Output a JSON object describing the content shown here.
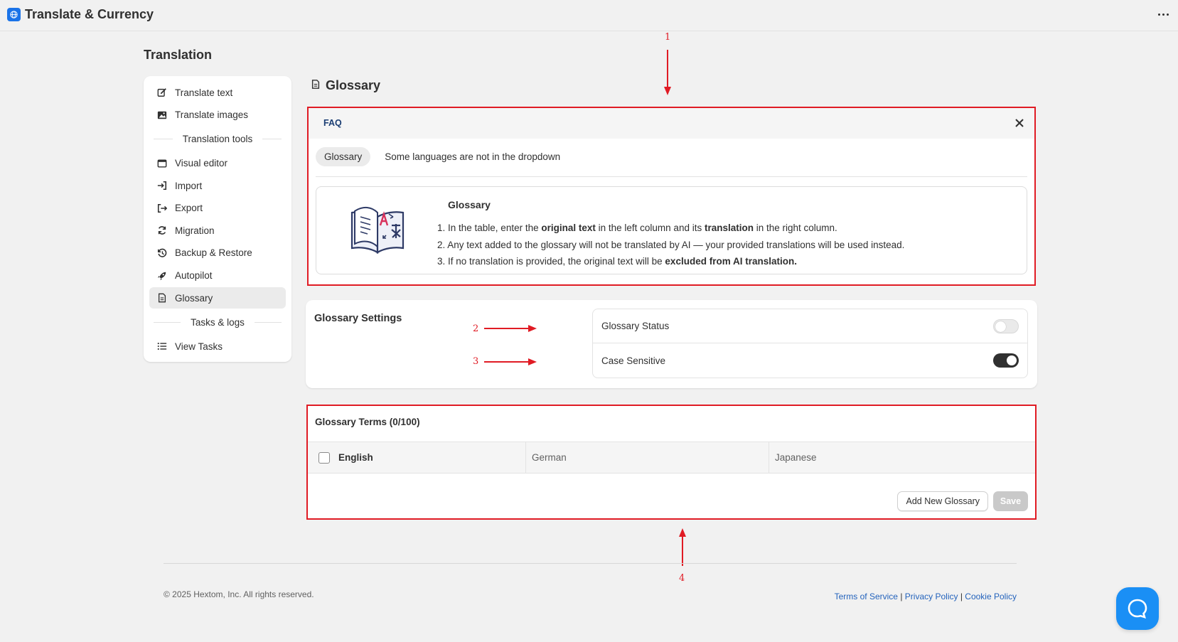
{
  "app": {
    "title": "Translate & Currency"
  },
  "page": {
    "title": "Translation"
  },
  "sidebar": {
    "items_top": [
      {
        "label": "Translate text",
        "icon": "edit-icon"
      },
      {
        "label": "Translate images",
        "icon": "image-icon"
      }
    ],
    "section_tools": "Translation tools",
    "items_tools": [
      {
        "label": "Visual editor",
        "icon": "window-icon"
      },
      {
        "label": "Import",
        "icon": "import-icon"
      },
      {
        "label": "Export",
        "icon": "export-icon"
      },
      {
        "label": "Migration",
        "icon": "refresh-icon"
      },
      {
        "label": "Backup & Restore",
        "icon": "history-icon"
      },
      {
        "label": "Autopilot",
        "icon": "rocket-icon"
      },
      {
        "label": "Glossary",
        "icon": "document-icon",
        "active": true
      }
    ],
    "section_tasks": "Tasks & logs",
    "items_tasks": [
      {
        "label": "View Tasks",
        "icon": "list-icon"
      }
    ]
  },
  "main": {
    "section_title": "Glossary",
    "faq": {
      "label": "FAQ",
      "tabs": [
        "Glossary",
        "Some languages are not in the dropdown"
      ],
      "heading": "Glossary",
      "items": {
        "i1_a": "1. In the table, enter the ",
        "i1_b": "original text",
        "i1_c": " in the left column and its ",
        "i1_d": "translation",
        "i1_e": " in the right column.",
        "i2": "2. Any text added to the glossary will not be translated by AI — your provided translations will be used instead.",
        "i3_a": "3. If no translation is provided, the original text will be ",
        "i3_b": "excluded from AI translation."
      }
    },
    "settings": {
      "title": "Glossary Settings",
      "status_label": "Glossary Status",
      "status_on": false,
      "case_label": "Case Sensitive",
      "case_on": true
    },
    "terms": {
      "title": "Glossary Terms (0/100)",
      "columns": [
        "English",
        "German",
        "Japanese"
      ],
      "add_label": "Add New Glossary",
      "save_label": "Save"
    }
  },
  "annotations": [
    "1",
    "2",
    "3",
    "4"
  ],
  "footer": {
    "copyright": "© 2025 Hextom, Inc. All rights reserved.",
    "links": [
      "Terms of Service",
      "Privacy Policy",
      "Cookie Policy"
    ],
    "separator": "|"
  },
  "colors": {
    "accent": "#1a73e8",
    "annotation": "#e01b24",
    "chat": "#1a8ff5"
  }
}
